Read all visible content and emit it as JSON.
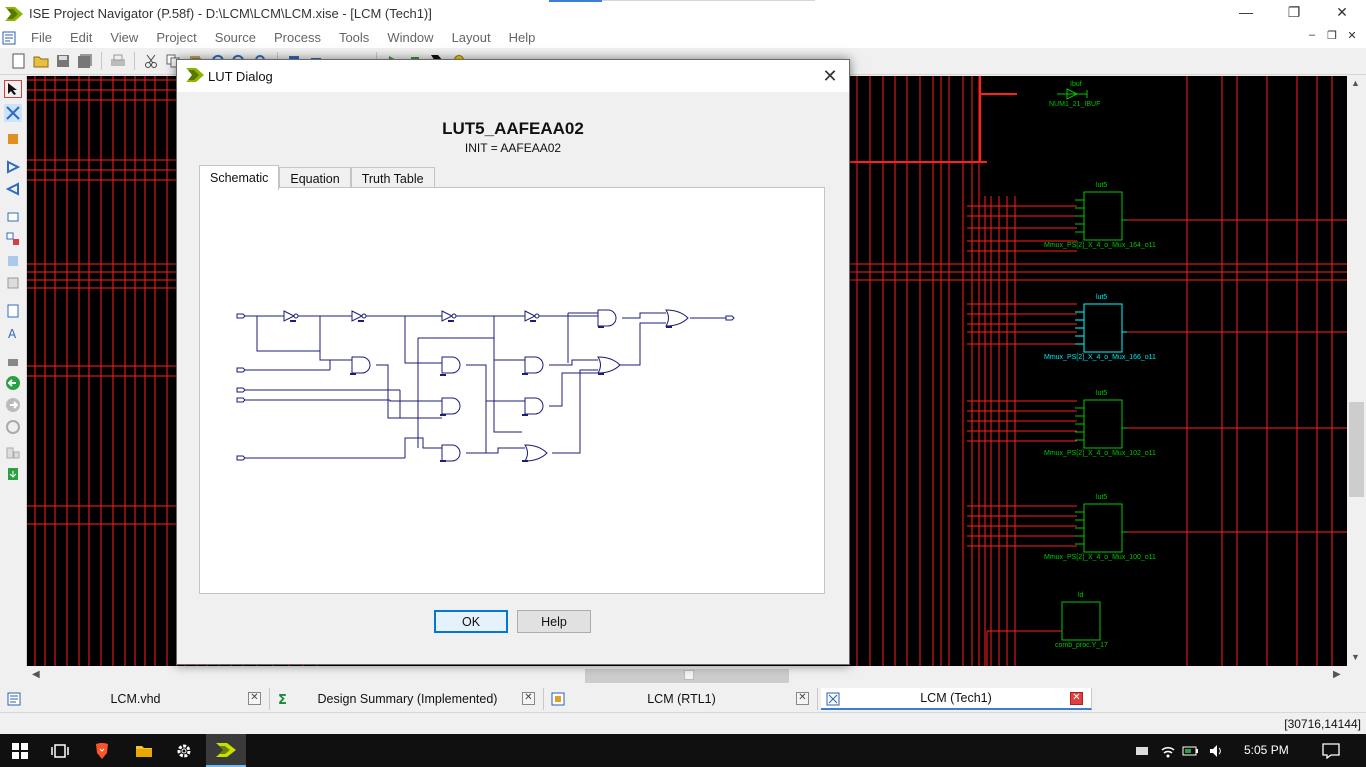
{
  "window": {
    "title": "ISE Project Navigator (P.58f) - D:\\LCM\\LCM\\LCM.xise - [LCM (Tech1)]",
    "controls": [
      "—",
      "❐",
      "✕"
    ]
  },
  "menu": {
    "items": [
      "File",
      "Edit",
      "View",
      "Project",
      "Source",
      "Process",
      "Tools",
      "Window",
      "Layout",
      "Help"
    ],
    "mdi_controls": [
      "–",
      "❐",
      "✕"
    ]
  },
  "schematic": {
    "components": [
      {
        "type": "ibuf",
        "name": "Ibuf",
        "instance": "NUM1_21_IBUF"
      },
      {
        "type": "lut5",
        "name": "lut5",
        "instance": "Mmux_PS[2]_X_4_o_Mux_164_o11"
      },
      {
        "type": "lut5",
        "name": "lut5",
        "instance": "Mmux_PS[2]_X_4_o_Mux_166_o11",
        "selected": true
      },
      {
        "type": "lut5",
        "name": "lut5",
        "instance": "Mmux_PS[2]_X_4_o_Mux_102_o11"
      },
      {
        "type": "lut5",
        "name": "lut5",
        "instance": "Mmux_PS[2]_X_4_o_Mux_100_o11"
      },
      {
        "type": "ld",
        "name": "ld",
        "instance": "comb_proc.Y_17"
      }
    ],
    "colors": {
      "wire": "#ff2020",
      "component": "#00c800",
      "selected": "#00ffff",
      "background": "#000000"
    }
  },
  "dialog": {
    "title": "LUT Dialog",
    "lut_name": "LUT5_AAFEAA02",
    "init": "INIT = AAFEAA02",
    "tabs": [
      {
        "label": "Schematic",
        "active": true
      },
      {
        "label": "Equation",
        "active": false
      },
      {
        "label": "Truth Table",
        "active": false
      }
    ],
    "ok_label": "OK",
    "help_label": "Help",
    "close": "✕"
  },
  "doc_tabs": [
    {
      "label": "LCM.vhd",
      "icon": "vhdl-file-icon",
      "active": false
    },
    {
      "label": "Design Summary (Implemented)",
      "icon": "sigma-icon",
      "active": false
    },
    {
      "label": "LCM (RTL1)",
      "icon": "schematic-icon",
      "active": false
    },
    {
      "label": "LCM (Tech1)",
      "icon": "schematic-icon",
      "active": true
    }
  ],
  "status": {
    "coords": "[30716,14144]"
  },
  "taskbar": {
    "clock": "5:05 PM"
  }
}
